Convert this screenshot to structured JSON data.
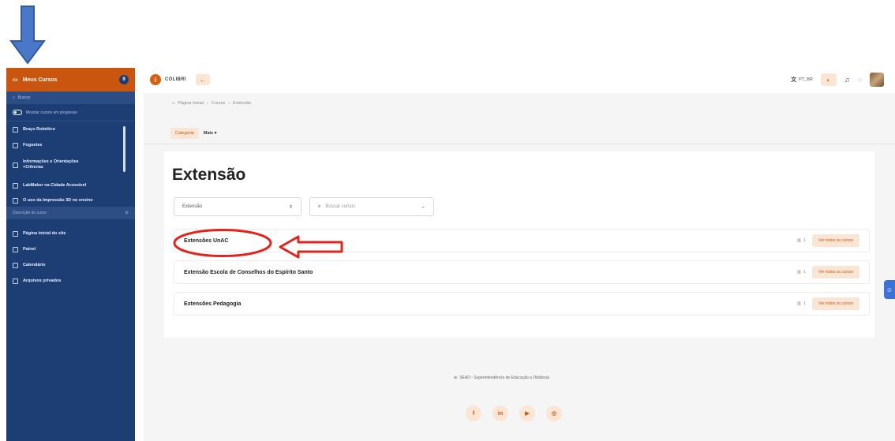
{
  "sidebar": {
    "header_label": "Meus Cursos",
    "header_badge": "9",
    "search_placeholder": "Buscar",
    "toggle_label": "Mostrar cursos em progresso",
    "courses": [
      {
        "label": "Braço Robótico"
      },
      {
        "label": "Foguetes"
      },
      {
        "label": "Informações e Orientações +Ciências"
      },
      {
        "label": "LabMaker na Cidade Acessível"
      },
      {
        "label": "O uso da Impressão 3D no ensino"
      }
    ],
    "desc_label": "Descrição do curso",
    "nav": [
      {
        "label": "Página inicial do site"
      },
      {
        "label": "Painel"
      },
      {
        "label": "Calendário"
      },
      {
        "label": "Arquivos privados"
      }
    ]
  },
  "header": {
    "brand": "COLIBRI",
    "lang": "PT_BR"
  },
  "breadcrumb": [
    "Página Inicial",
    "Cursos",
    "Extensão"
  ],
  "tabs": {
    "category": "Categoria",
    "more": "Mais"
  },
  "page": {
    "title": "Extensão",
    "select_value": "Extensão",
    "search_placeholder": "Buscar cursos"
  },
  "categories": [
    {
      "name": "Extensões UnAC",
      "count": "1",
      "action": "Ver todos os cursos"
    },
    {
      "name": "Extensão Escola de Conselhos do Espírito Santo",
      "count": "1",
      "action": "Ver todos os cursos"
    },
    {
      "name": "Extensões Pedagogia",
      "count": "1",
      "action": "Ver todos os cursos"
    }
  ],
  "footer": {
    "text": "SEAD - Superintendência de Educação a Distância"
  },
  "colors": {
    "sidebar_bg": "#1d3d75",
    "accent_orange": "#c9550f",
    "annotation_red": "#e0231c",
    "annotation_blue": "#4a78c6"
  }
}
